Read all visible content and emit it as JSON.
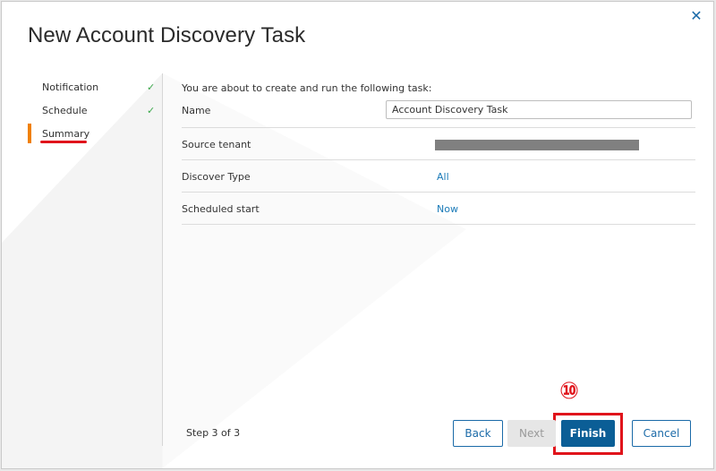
{
  "dialog": {
    "title": "New Account Discovery Task",
    "close_icon": "close-icon"
  },
  "steps": [
    {
      "label": "Notification",
      "done": true,
      "check": "✓"
    },
    {
      "label": "Schedule",
      "done": true,
      "check": "✓"
    },
    {
      "label": "Summary",
      "active": true
    }
  ],
  "summary": {
    "intro": "You are about to create and run the following task:",
    "name_label": "Name",
    "name_value": "Account Discovery Task",
    "source_tenant_label": "Source tenant",
    "discover_type_label": "Discover Type",
    "discover_type_value": "All",
    "scheduled_start_label": "Scheduled start",
    "scheduled_start_value": "Now"
  },
  "footer": {
    "step_count": "Step 3 of 3",
    "back_label": "Back",
    "next_label": "Next",
    "finish_label": "Finish",
    "cancel_label": "Cancel"
  },
  "annotation": {
    "marker": "⑩"
  },
  "colors": {
    "accent": "#0b5e96",
    "link": "#1a7ab8",
    "active_step": "#f08000",
    "annotation": "#e0141b",
    "check": "#3aa84a"
  }
}
